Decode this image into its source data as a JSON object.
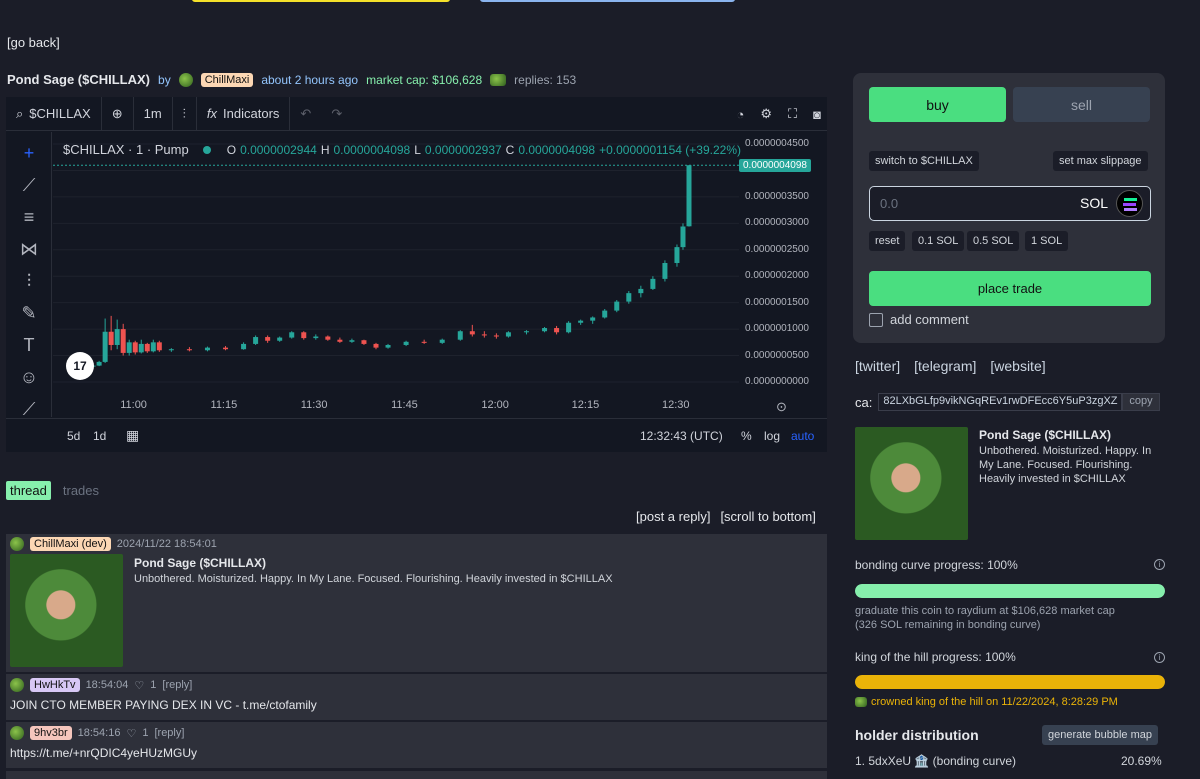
{
  "nav": {
    "go_back": "[go back]"
  },
  "coin": {
    "name": "Pond Sage ($CHILLAX)",
    "by": "by",
    "creator": "ChillMaxi",
    "created": "about 2 hours ago",
    "market_cap": "market cap: $106,628",
    "replies": "replies: 153"
  },
  "chart": {
    "symbol": "$CHILLAX",
    "interval": "1m",
    "indicators_label": "Indicators",
    "legend_title": "$CHILLAX · 1 · Pump",
    "ohlc": {
      "o_label": "O",
      "o": "0.0000002944",
      "h_label": "H",
      "h": "0.0000004098",
      "l_label": "L",
      "l": "0.0000002937",
      "c_label": "C",
      "c": "0.0000004098",
      "change": "+0.0000001154 (+39.22%)"
    },
    "last_price": "0.0000004098",
    "price_ticks": [
      "0.0000004500",
      "0.0000004000",
      "0.0000003500",
      "0.0000003000",
      "0.0000002500",
      "0.0000002000",
      "0.0000001500",
      "0.0000001000",
      "0.0000000500",
      "0.0000000000"
    ],
    "time_ticks": [
      "11:00",
      "11:15",
      "11:30",
      "11:45",
      "12:00",
      "12:15",
      "12:30"
    ],
    "range_5d": "5d",
    "range_1d": "1d",
    "clock": "12:32:43 (UTC)",
    "pct": "%",
    "log": "log",
    "auto": "auto",
    "logo": "17"
  },
  "chart_data": {
    "type": "candlestick",
    "title": "$CHILLAX · 1 · Pump",
    "y_range": [
      0,
      4.5e-07
    ],
    "x_range": [
      "10:48",
      "12:32"
    ],
    "candles": [
      {
        "t": "10:53",
        "o": 3e-08,
        "h": 3.2e-08,
        "l": 2.8e-08,
        "c": 3.1e-08
      },
      {
        "t": "10:54",
        "o": 3.1e-08,
        "h": 4e-08,
        "l": 3e-08,
        "c": 3.8e-08
      },
      {
        "t": "10:55",
        "o": 3.8e-08,
        "h": 1.2e-07,
        "l": 3.6e-08,
        "c": 9.5e-08
      },
      {
        "t": "10:56",
        "o": 9.5e-08,
        "h": 1.25e-07,
        "l": 6e-08,
        "c": 7e-08
      },
      {
        "t": "10:57",
        "o": 7e-08,
        "h": 1.18e-07,
        "l": 6.2e-08,
        "c": 1e-07
      },
      {
        "t": "10:58",
        "o": 1e-07,
        "h": 1.1e-07,
        "l": 5e-08,
        "c": 5.5e-08
      },
      {
        "t": "10:59",
        "o": 5.5e-08,
        "h": 8e-08,
        "l": 5e-08,
        "c": 7.5e-08
      },
      {
        "t": "11:00",
        "o": 7.5e-08,
        "h": 7.8e-08,
        "l": 5.2e-08,
        "c": 5.6e-08
      },
      {
        "t": "11:01",
        "o": 5.6e-08,
        "h": 8e-08,
        "l": 5.4e-08,
        "c": 7.2e-08
      },
      {
        "t": "11:02",
        "o": 7.2e-08,
        "h": 7.4e-08,
        "l": 5.5e-08,
        "c": 5.8e-08
      },
      {
        "t": "11:03",
        "o": 5.8e-08,
        "h": 8e-08,
        "l": 5.6e-08,
        "c": 7.5e-08
      },
      {
        "t": "11:04",
        "o": 7.5e-08,
        "h": 7.8e-08,
        "l": 5.7e-08,
        "c": 6e-08
      },
      {
        "t": "11:06",
        "o": 6e-08,
        "h": 6.4e-08,
        "l": 5.7e-08,
        "c": 6.2e-08
      },
      {
        "t": "11:09",
        "o": 6.2e-08,
        "h": 6.6e-08,
        "l": 5.8e-08,
        "c": 6e-08
      },
      {
        "t": "11:12",
        "o": 6e-08,
        "h": 6.7e-08,
        "l": 5.8e-08,
        "c": 6.5e-08
      },
      {
        "t": "11:15",
        "o": 6.5e-08,
        "h": 6.8e-08,
        "l": 6e-08,
        "c": 6.2e-08
      },
      {
        "t": "11:18",
        "o": 6.2e-08,
        "h": 7.5e-08,
        "l": 6.1e-08,
        "c": 7.2e-08
      },
      {
        "t": "11:20",
        "o": 7.2e-08,
        "h": 8.8e-08,
        "l": 7e-08,
        "c": 8.5e-08
      },
      {
        "t": "11:22",
        "o": 8.5e-08,
        "h": 8.8e-08,
        "l": 7.4e-08,
        "c": 7.8e-08
      },
      {
        "t": "11:24",
        "o": 7.8e-08,
        "h": 8.6e-08,
        "l": 7.6e-08,
        "c": 8.4e-08
      },
      {
        "t": "11:26",
        "o": 8.4e-08,
        "h": 9.6e-08,
        "l": 8.2e-08,
        "c": 9.4e-08
      },
      {
        "t": "11:28",
        "o": 9.4e-08,
        "h": 9.6e-08,
        "l": 8e-08,
        "c": 8.3e-08
      },
      {
        "t": "11:30",
        "o": 8.3e-08,
        "h": 9e-08,
        "l": 8e-08,
        "c": 8.6e-08
      },
      {
        "t": "11:32",
        "o": 8.6e-08,
        "h": 8.8e-08,
        "l": 7.8e-08,
        "c": 8e-08
      },
      {
        "t": "11:34",
        "o": 8e-08,
        "h": 8.4e-08,
        "l": 7.4e-08,
        "c": 7.6e-08
      },
      {
        "t": "11:36",
        "o": 7.6e-08,
        "h": 8.2e-08,
        "l": 7.4e-08,
        "c": 7.9e-08
      },
      {
        "t": "11:38",
        "o": 7.9e-08,
        "h": 8e-08,
        "l": 7e-08,
        "c": 7.2e-08
      },
      {
        "t": "11:40",
        "o": 7.2e-08,
        "h": 7.4e-08,
        "l": 6.2e-08,
        "c": 6.5e-08
      },
      {
        "t": "11:42",
        "o": 6.5e-08,
        "h": 7.2e-08,
        "l": 6.3e-08,
        "c": 7e-08
      },
      {
        "t": "11:45",
        "o": 7e-08,
        "h": 7.8e-08,
        "l": 6.8e-08,
        "c": 7.6e-08
      },
      {
        "t": "11:48",
        "o": 7.6e-08,
        "h": 8e-08,
        "l": 7.2e-08,
        "c": 7.4e-08
      },
      {
        "t": "11:51",
        "o": 7.4e-08,
        "h": 8.2e-08,
        "l": 7.2e-08,
        "c": 8e-08
      },
      {
        "t": "11:54",
        "o": 8e-08,
        "h": 9.8e-08,
        "l": 7.8e-08,
        "c": 9.6e-08
      },
      {
        "t": "11:56",
        "o": 9.6e-08,
        "h": 1.08e-07,
        "l": 8.6e-08,
        "c": 9e-08
      },
      {
        "t": "11:58",
        "o": 9e-08,
        "h": 9.6e-08,
        "l": 8.4e-08,
        "c": 8.8e-08
      },
      {
        "t": "12:00",
        "o": 8.8e-08,
        "h": 9.2e-08,
        "l": 8.2e-08,
        "c": 8.6e-08
      },
      {
        "t": "12:02",
        "o": 8.6e-08,
        "h": 9.6e-08,
        "l": 8.4e-08,
        "c": 9.4e-08
      },
      {
        "t": "12:05",
        "o": 9.4e-08,
        "h": 9.8e-08,
        "l": 9e-08,
        "c": 9.6e-08
      },
      {
        "t": "12:08",
        "o": 9.6e-08,
        "h": 1.04e-07,
        "l": 9.4e-08,
        "c": 1.02e-07
      },
      {
        "t": "12:10",
        "o": 1.02e-07,
        "h": 1.06e-07,
        "l": 9e-08,
        "c": 9.4e-08
      },
      {
        "t": "12:12",
        "o": 9.4e-08,
        "h": 1.15e-07,
        "l": 9.2e-08,
        "c": 1.12e-07
      },
      {
        "t": "12:14",
        "o": 1.12e-07,
        "h": 1.18e-07,
        "l": 1.08e-07,
        "c": 1.16e-07
      },
      {
        "t": "12:16",
        "o": 1.16e-07,
        "h": 1.24e-07,
        "l": 1.1e-07,
        "c": 1.22e-07
      },
      {
        "t": "12:18",
        "o": 1.22e-07,
        "h": 1.38e-07,
        "l": 1.2e-07,
        "c": 1.35e-07
      },
      {
        "t": "12:20",
        "o": 1.35e-07,
        "h": 1.55e-07,
        "l": 1.32e-07,
        "c": 1.52e-07
      },
      {
        "t": "12:22",
        "o": 1.52e-07,
        "h": 1.72e-07,
        "l": 1.48e-07,
        "c": 1.68e-07
      },
      {
        "t": "12:24",
        "o": 1.68e-07,
        "h": 1.82e-07,
        "l": 1.6e-07,
        "c": 1.76e-07
      },
      {
        "t": "12:26",
        "o": 1.76e-07,
        "h": 2e-07,
        "l": 1.74e-07,
        "c": 1.95e-07
      },
      {
        "t": "12:28",
        "o": 1.95e-07,
        "h": 2.3e-07,
        "l": 1.9e-07,
        "c": 2.25e-07
      },
      {
        "t": "12:30",
        "o": 2.25e-07,
        "h": 2.6e-07,
        "l": 2.18e-07,
        "c": 2.55e-07
      },
      {
        "t": "12:31",
        "o": 2.55e-07,
        "h": 3e-07,
        "l": 2.5e-07,
        "c": 2.94e-07
      },
      {
        "t": "12:32",
        "o": 2.944e-07,
        "h": 4.098e-07,
        "l": 2.937e-07,
        "c": 4.098e-07
      }
    ]
  },
  "thread": {
    "tab_thread": "thread",
    "tab_trades": "trades",
    "post_reply": "[post a reply]",
    "scroll_bottom": "[scroll to bottom]",
    "op": {
      "user": "ChillMaxi (dev)",
      "time": "2024/11/22 18:54:01",
      "title": "Pond Sage ($CHILLAX)",
      "body": "Unbothered. Moisturized. Happy. In My Lane. Focused. Flourishing. Heavily invested in $CHILLAX"
    },
    "replies": [
      {
        "user": "HwHkTv",
        "time": "18:54:04",
        "likes": "1",
        "reply": "[reply]",
        "text": "JOIN CTO MEMBER PAYING DEX IN VC - t.me/ctofamily"
      },
      {
        "user": "9hv3br",
        "time": "18:54:16",
        "likes": "1",
        "reply": "[reply]",
        "text": "https://t.me/+nrQDIC4yeHUzMGUy"
      }
    ]
  },
  "trade": {
    "buy": "buy",
    "sell": "sell",
    "switch": "switch to $CHILLAX",
    "slippage": "set max slippage",
    "amount_placeholder": "0.0",
    "currency": "SOL",
    "presets": [
      "reset",
      "0.1 SOL",
      "0.5 SOL",
      "1 SOL"
    ],
    "place_trade": "place trade",
    "add_comment": "add comment",
    "colors": {
      "green": "#4ade80",
      "gray": "#374151"
    }
  },
  "info": {
    "twitter": "[twitter]",
    "telegram": "[telegram]",
    "website": "[website]",
    "ca_label": "ca:",
    "ca": "82LXbGLfp9vikNGqREv1rwDFEcc6Y5uP3zgXZ",
    "copy": "copy",
    "card_title": "Pond Sage ($CHILLAX)",
    "card_desc": "Unbothered. Moisturized. Happy. In My Lane. Focused. Flourishing. Heavily invested in $CHILLAX",
    "bonding_label": "bonding curve progress: 100%",
    "bonding_progress": 1.0,
    "bonding_note1": "graduate this coin to raydium at $106,628 market cap",
    "bonding_note2": "(326 SOL remaining in bonding curve)",
    "koth_label": "king of the hill progress: 100%",
    "koth_progress": 1.0,
    "koth_note": "crowned king of the hill on 11/22/2024, 8:28:29 PM",
    "holder_title": "holder distribution",
    "bubble_map": "generate bubble map",
    "holders": [
      {
        "name": "1. 5dxXeU 🏦 (bonding curve)",
        "pct": "20.69%"
      }
    ]
  }
}
